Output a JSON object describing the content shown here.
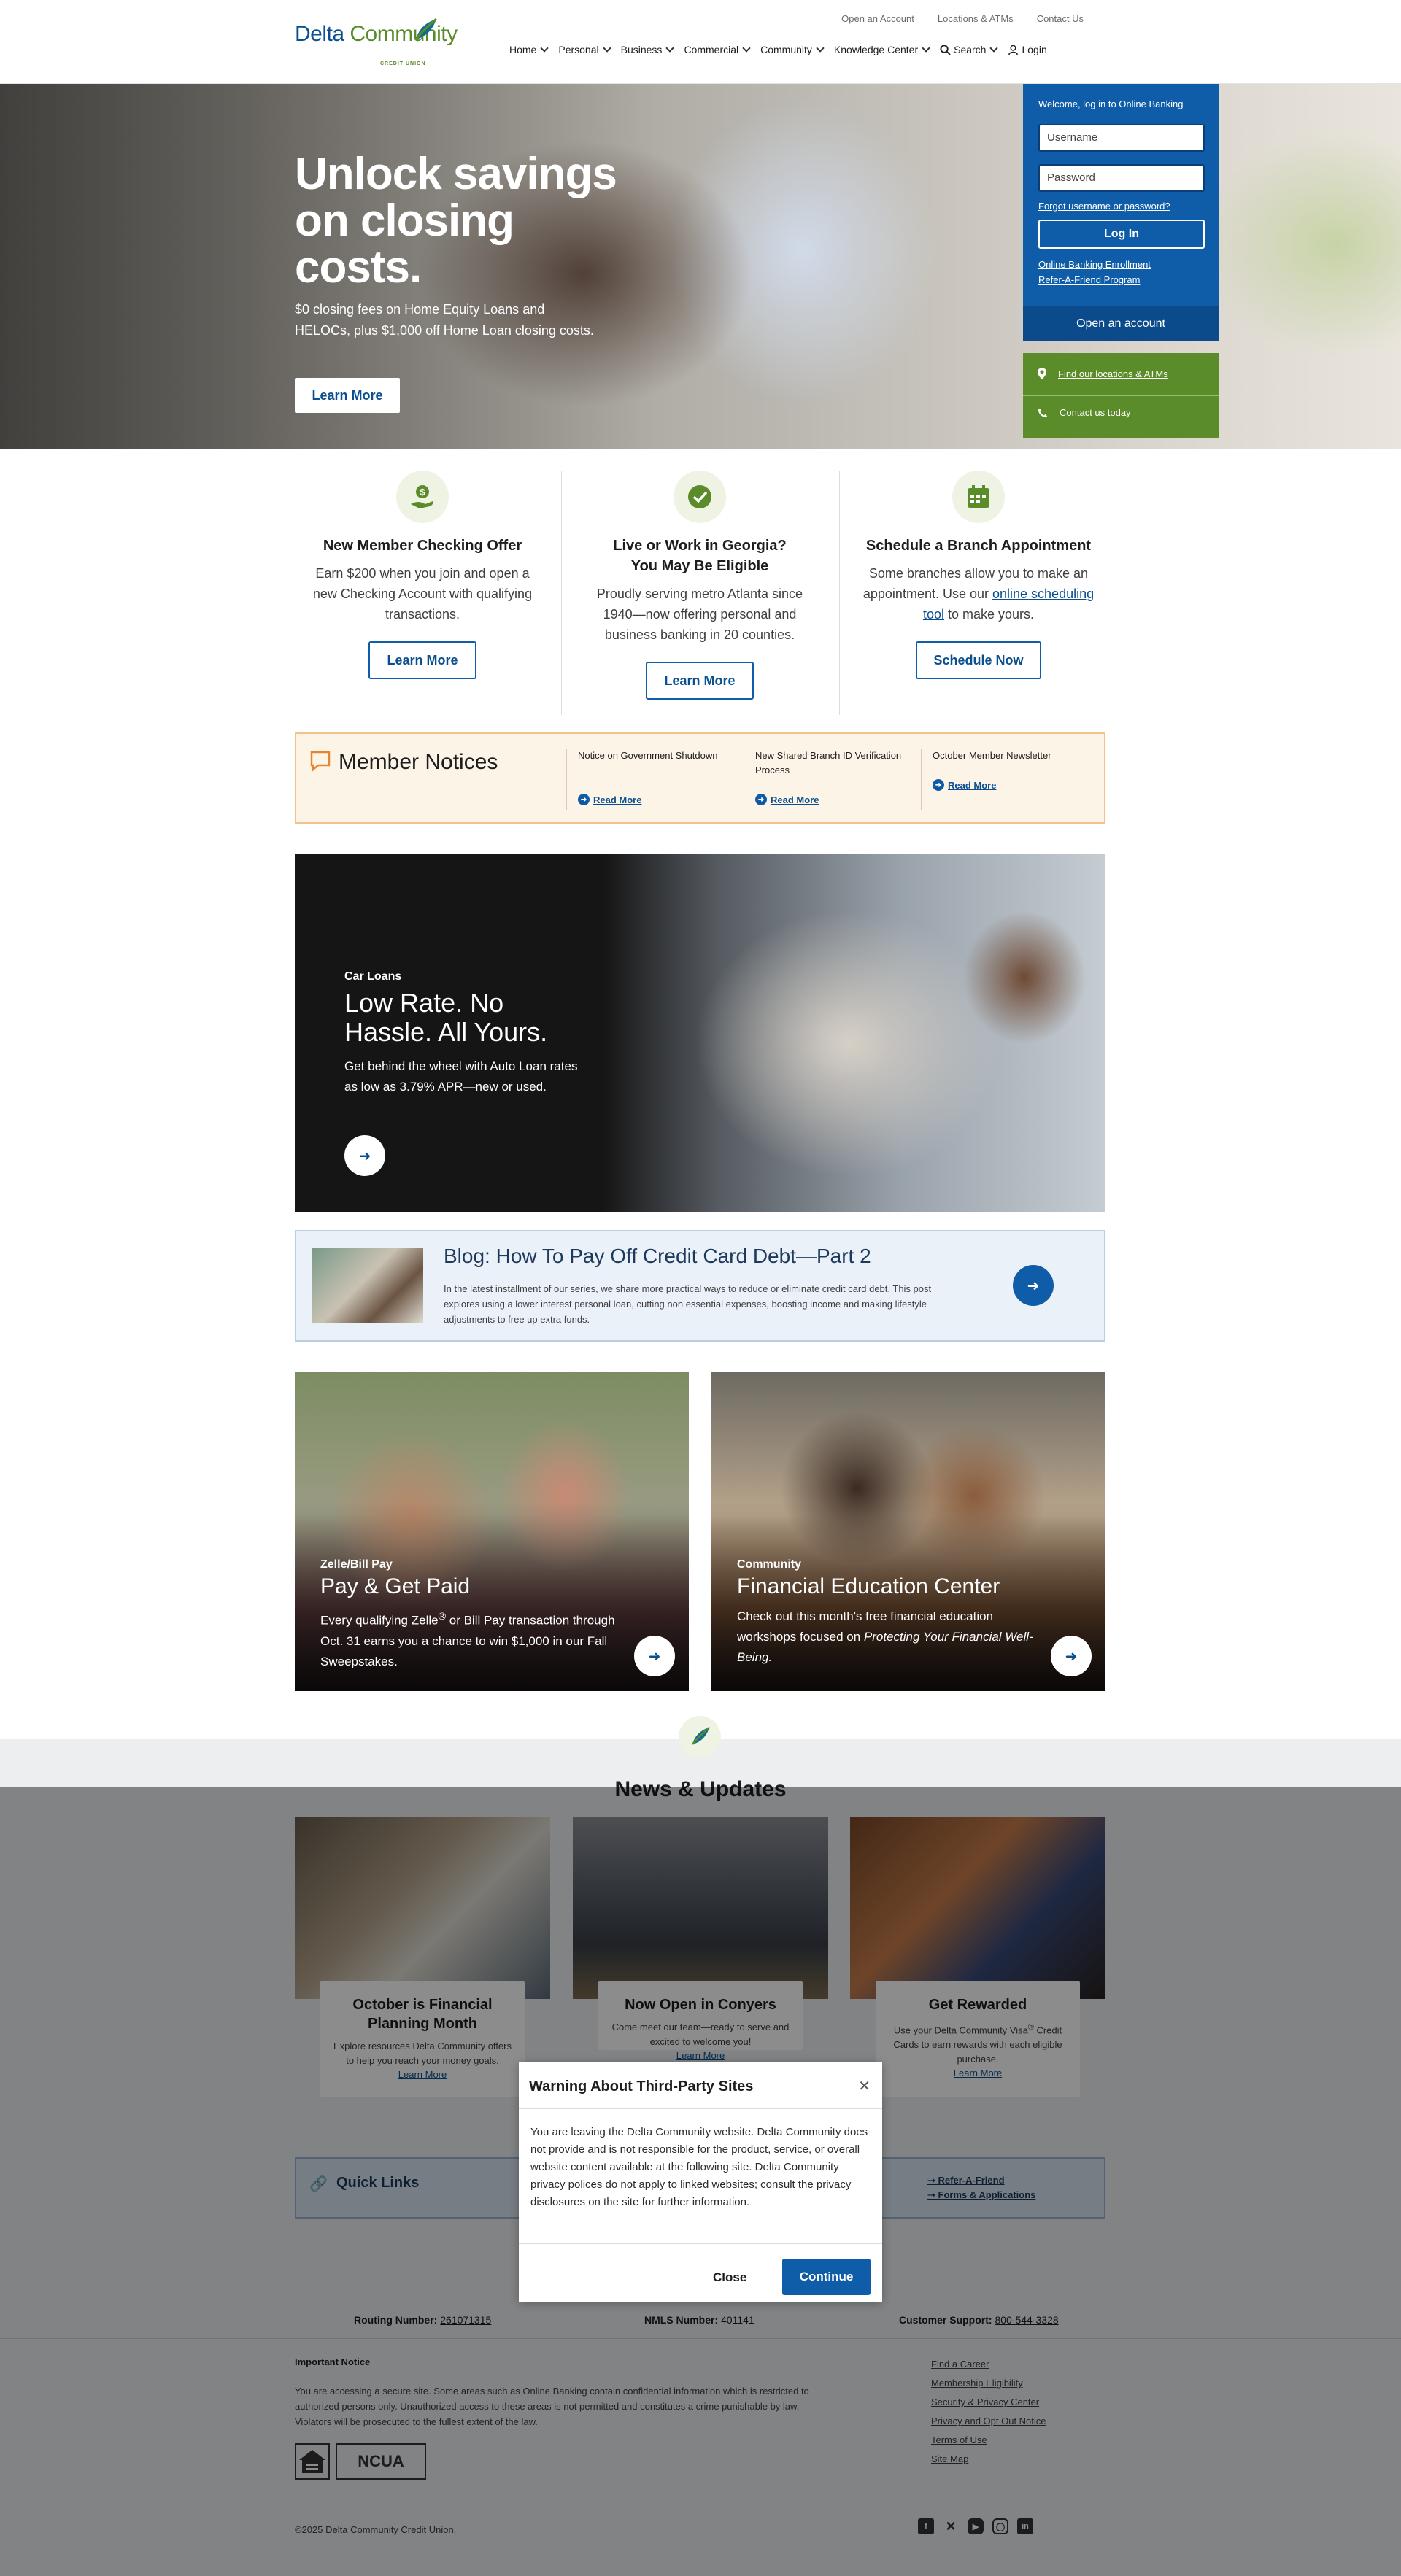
{
  "header": {
    "utility_links": [
      "Open an Account",
      "Locations & ATMs",
      "Contact Us"
    ],
    "logo": {
      "word1": "Delta",
      "word2": "Community",
      "sub": "CREDIT UNION"
    },
    "nav": [
      "Home",
      "Personal",
      "Business",
      "Commercial",
      "Community",
      "Knowledge Center"
    ],
    "search_label": "Search",
    "login_label": "Login"
  },
  "hero": {
    "title": "Unlock savings on closing costs.",
    "text": "$0 closing fees on Home Equity Loans and HELOCs, plus $1,000 off Home Loan closing costs.",
    "button": "Learn More"
  },
  "login_panel": {
    "welcome": "Welcome, log in to Online Banking",
    "username_placeholder": "Username",
    "password_placeholder": "Password",
    "forgot": "Forgot username or password?",
    "login_button": "Log In",
    "enrollment": "Online Banking Enrollment",
    "refer": "Refer-A-Friend Program",
    "open_account": "Open an account",
    "find_locations": "Find our locations & ATMs",
    "contact_today": "Contact us today"
  },
  "features": [
    {
      "title": "New Member Checking Offer",
      "text": "Earn $200 when you join and open a new Checking Account with qualifying transactions.",
      "button": "Learn More"
    },
    {
      "title": "Live or Work in Georgia? You May Be Eligible",
      "text": "Proudly serving metro Atlanta since 1940—now offering personal and business banking in 20 counties.",
      "button": "Learn More"
    },
    {
      "title": "Schedule a Branch Appointment",
      "text_before": "Some branches allow you to make an appointment. Use our ",
      "text_link": "online scheduling tool",
      "text_after": " to make yours.",
      "button": "Schedule Now"
    }
  ],
  "notices": {
    "title": "Member Notices",
    "items": [
      {
        "title": "Notice on Government Shutdown",
        "link": "Read More"
      },
      {
        "title": "New Shared Branch ID Verification Process",
        "link": "Read More"
      },
      {
        "title": "October Member Newsletter",
        "link": "Read More"
      }
    ]
  },
  "car_loans": {
    "tag": "Car Loans",
    "title": "Low Rate. No Hassle. All Yours.",
    "text": "Get behind the wheel with Auto Loan rates as low as 3.79% APR—new or used."
  },
  "blog": {
    "title": "Blog: How To Pay Off Credit Card Debt—Part 2",
    "text": "In the latest installment of our series, we share more practical ways to reduce or eliminate credit card debt. This post explores using a lower interest personal loan, cutting non essential expenses, boosting income and making lifestyle adjustments to free up extra funds."
  },
  "cards": [
    {
      "tag": "Zelle/Bill Pay",
      "title": "Pay & Get Paid",
      "text_a": "Every qualifying Zelle",
      "sup": "®",
      "text_b": " or Bill Pay transaction through Oct. 31 earns you a chance to win $1,000 in our Fall Sweepstakes."
    },
    {
      "tag": "Community",
      "title": "Financial Education Center",
      "text_a": "Check out this month's free financial education workshops focused on ",
      "italic": "Protecting Your Financial Well-Being."
    }
  ],
  "news": {
    "title": "News & Updates",
    "items": [
      {
        "title": "October is Financial Planning Month",
        "text": "Explore resources Delta Community offers to help you reach your money goals.",
        "link": "Learn More"
      },
      {
        "title": "Now Open in Conyers",
        "text": "Come meet our team—ready to serve and excited to welcome you!",
        "link": "Learn More"
      },
      {
        "title": "Get Rewarded",
        "text_a": "Use your Delta Community Visa",
        "sup": "®",
        "text_b": " Credit Cards to earn rewards with each eligible purchase.",
        "link": "Learn More"
      }
    ]
  },
  "quick_links": {
    "title": "Quick Links",
    "items": [
      "Refer-A-Friend",
      "Forms & Applications"
    ]
  },
  "footer": {
    "routing_label": "Routing Number:",
    "routing_value": "261071315",
    "nmls_label": "NMLS Number:",
    "nmls_value": "401141",
    "support_label": "Customer Support:",
    "support_value": "800-544-3328",
    "important_title": "Important Notice",
    "important_text": "You are accessing a secure site. Some areas such as Online Banking contain confidential information which is restricted to authorized persons only. Unauthorized access to these areas is not permitted and constitutes a crime punishable by law. Violators will be prosecuted to the fullest extent of the law.",
    "links": [
      "Find a Career",
      "Membership Eligibility",
      "Security & Privacy Center",
      "Privacy and Opt Out Notice",
      "Terms of Use",
      "Site Map"
    ],
    "ehl": "EQUAL HOUSING LENDER",
    "ncua": "NCUA",
    "copyright": "©2025 Delta Community Credit Union.",
    "social": [
      "facebook-icon",
      "x-icon",
      "youtube-icon",
      "instagram-icon",
      "linkedin-icon"
    ]
  },
  "modal": {
    "title": "Warning About Third-Party Sites",
    "body": "You are leaving the Delta Community website. Delta Community does not provide and is not responsible for the product, service, or overall website content available at the following site. Delta Community privacy polices do not apply to linked websites; consult the privacy disclosures on the site for further information.",
    "close": "Close",
    "continue": "Continue"
  },
  "colors": {
    "brand_blue": "#0f5ca8",
    "brand_green": "#5b8c2a",
    "notice_bg": "#fdf4e8"
  }
}
